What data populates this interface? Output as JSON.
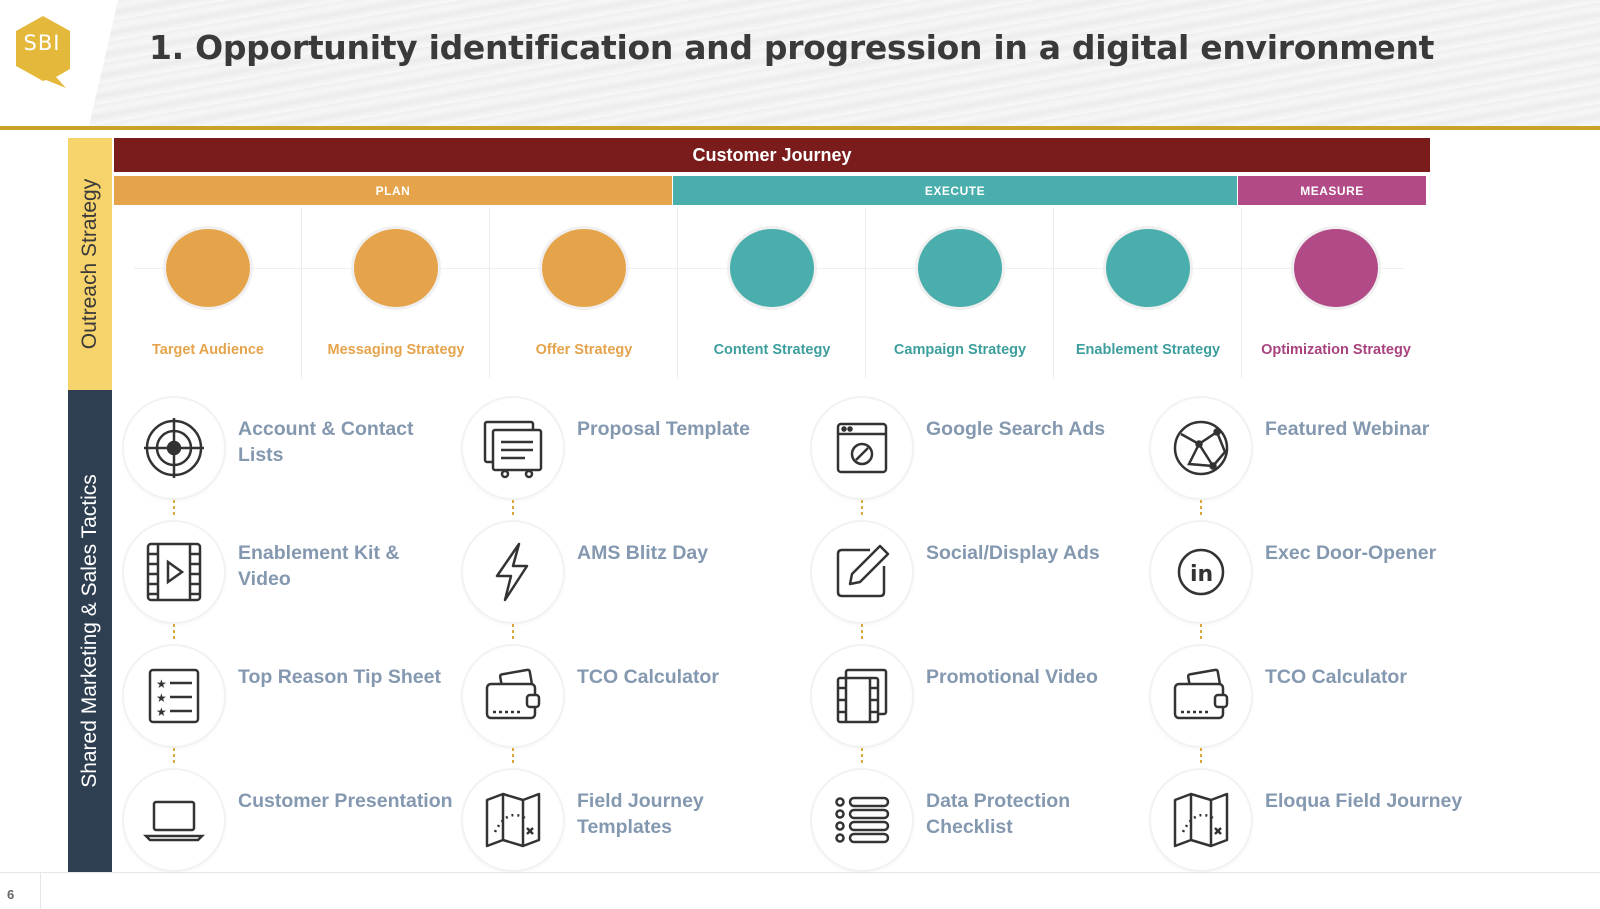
{
  "header": {
    "logo_text": "SBI",
    "title": "1. Opportunity identification and progression in a digital environment"
  },
  "colors": {
    "plan": "#e5a44c",
    "execute": "#4aaead",
    "measure": "#b24a87",
    "journey": "#7b1c1c",
    "outreach_band": "#f7d36b",
    "tactics_band": "#2e3f52",
    "tactic_text": "#8498b0",
    "connector": "#d9a93a"
  },
  "side_labels": {
    "outreach": "Outreach Strategy",
    "tactics": "Shared Marketing & Sales  Tactics"
  },
  "journey": {
    "title": "Customer Journey",
    "phases": [
      {
        "label": "PLAN"
      },
      {
        "label": "EXECUTE"
      },
      {
        "label": "MEASURE"
      }
    ]
  },
  "stages": [
    {
      "label": "Target Audience",
      "phase": "plan"
    },
    {
      "label": "Messaging Strategy",
      "phase": "plan"
    },
    {
      "label": "Offer Strategy",
      "phase": "plan"
    },
    {
      "label": "Content Strategy",
      "phase": "execute"
    },
    {
      "label": "Campaign Strategy",
      "phase": "execute"
    },
    {
      "label": "Enablement Strategy",
      "phase": "execute"
    },
    {
      "label": "Optimization Strategy",
      "phase": "measure"
    }
  ],
  "tactics": {
    "columns": [
      [
        {
          "label": "Account & Contact Lists",
          "icon": "target-icon"
        },
        {
          "label": "Enablement Kit & Video",
          "icon": "video-film-icon"
        },
        {
          "label": "Top Reason Tip Sheet",
          "icon": "star-checklist-icon"
        },
        {
          "label": "Customer Presentation",
          "icon": "laptop-icon"
        }
      ],
      [
        {
          "label": "Proposal Template",
          "icon": "document-template-icon"
        },
        {
          "label": "AMS Blitz Day",
          "icon": "lightning-icon"
        },
        {
          "label": "TCO Calculator",
          "icon": "wallet-icon"
        },
        {
          "label": "Field Journey Templates",
          "icon": "map-icon"
        }
      ],
      [
        {
          "label": "Google Search Ads",
          "icon": "browser-ad-icon"
        },
        {
          "label": "Social/Display Ads",
          "icon": "edit-pencil-icon"
        },
        {
          "label": "Promotional Video",
          "icon": "film-strip-icon"
        },
        {
          "label": "Data Protection Checklist",
          "icon": "list-icon"
        }
      ],
      [
        {
          "label": "Featured Webinar",
          "icon": "globe-network-icon"
        },
        {
          "label": "Exec Door-Opener",
          "icon": "linkedin-icon"
        },
        {
          "label": "TCO Calculator",
          "icon": "wallet-icon"
        },
        {
          "label": "Eloqua Field Journey",
          "icon": "map-icon"
        }
      ]
    ]
  },
  "footer": {
    "page_number": "6"
  }
}
